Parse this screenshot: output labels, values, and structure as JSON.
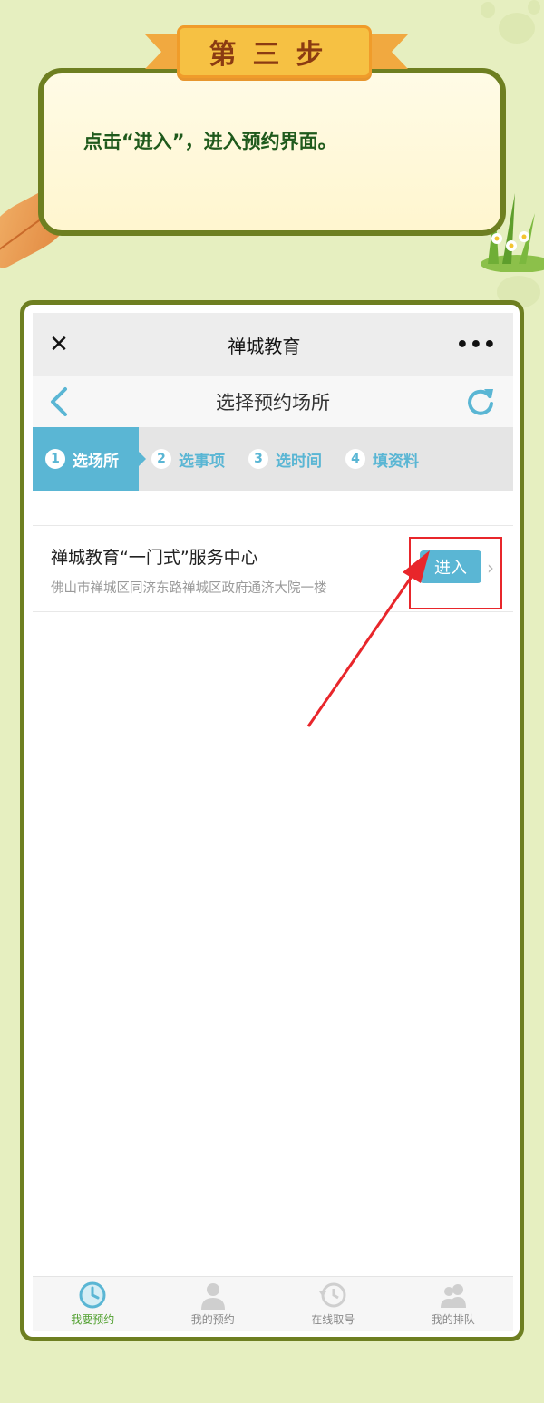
{
  "banner": {
    "step_title": "第三步",
    "instruction": "点击“进入”，进入预约界面。"
  },
  "wechat_bar": {
    "title": "禅城教育",
    "close_icon": "close-icon",
    "more_icon": "more-icon"
  },
  "nav": {
    "title": "选择预约场所",
    "back_icon": "back-arrow-icon",
    "refresh_icon": "refresh-icon"
  },
  "steps": [
    {
      "num": "1",
      "label": "选场所",
      "active": true
    },
    {
      "num": "2",
      "label": "选事项",
      "active": false
    },
    {
      "num": "3",
      "label": "选时间",
      "active": false
    },
    {
      "num": "4",
      "label": "填资料",
      "active": false
    }
  ],
  "venue": {
    "name": "禅城教育“一门式”服务中心",
    "address": "佛山市禅城区同济东路禅城区政府通济大院一楼",
    "enter_label": "进入",
    "chevron": "›"
  },
  "tabs": [
    {
      "label": "我要预约",
      "icon": "clock-icon",
      "active": true
    },
    {
      "label": "我的预约",
      "icon": "person-icon",
      "active": false
    },
    {
      "label": "在线取号",
      "icon": "history-icon",
      "active": false
    },
    {
      "label": "我的排队",
      "icon": "group-icon",
      "active": false
    }
  ],
  "colors": {
    "background": "#e6efc0",
    "frame": "#6e7f21",
    "accent": "#5ab6d4",
    "active_tab": "#4f9f2d",
    "highlight": "#e8262b"
  }
}
